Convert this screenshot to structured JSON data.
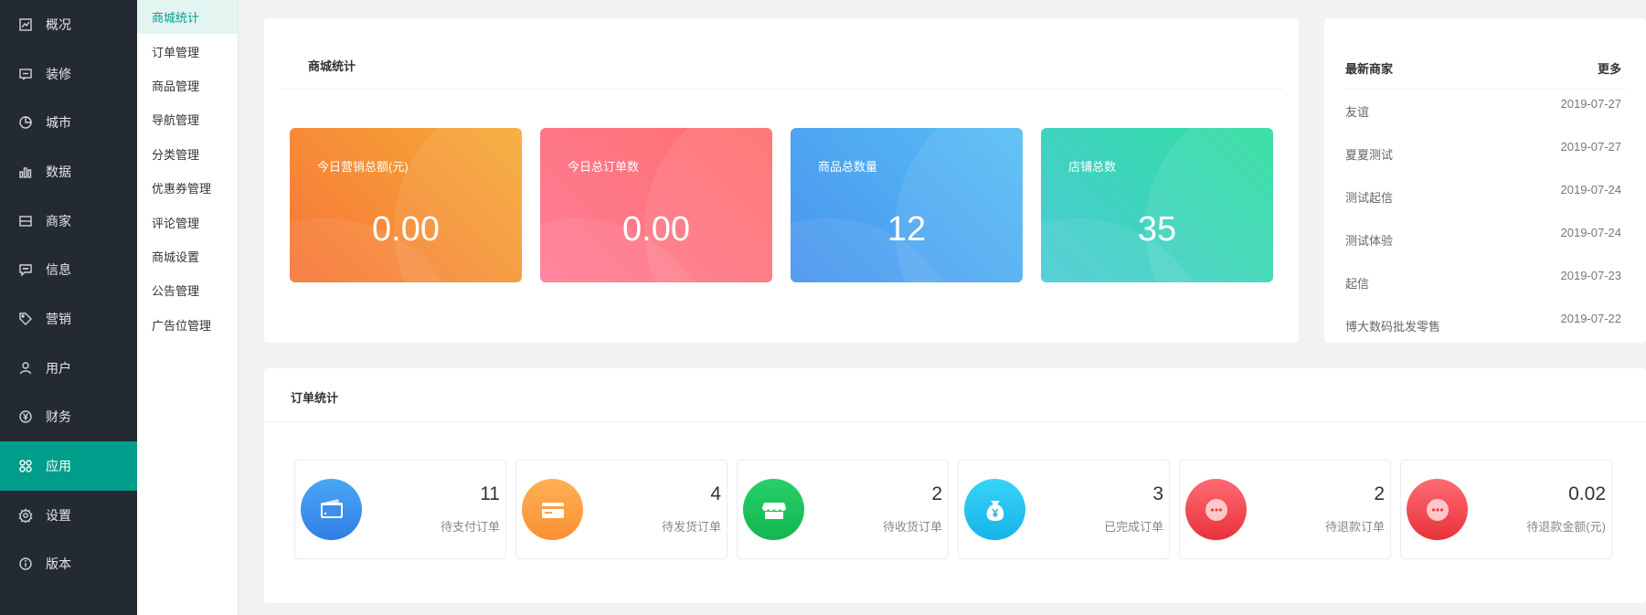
{
  "sidebar": {
    "items": [
      {
        "label": "概况",
        "icon": "overview-icon"
      },
      {
        "label": "装修",
        "icon": "decoration-icon"
      },
      {
        "label": "城市",
        "icon": "city-icon"
      },
      {
        "label": "数据",
        "icon": "chart-icon"
      },
      {
        "label": "商家",
        "icon": "merchant-icon"
      },
      {
        "label": "信息",
        "icon": "message-icon"
      },
      {
        "label": "营销",
        "icon": "tag-icon"
      },
      {
        "label": "用户",
        "icon": "user-icon"
      },
      {
        "label": "财务",
        "icon": "yen-icon"
      },
      {
        "label": "应用",
        "icon": "apps-icon"
      },
      {
        "label": "设置",
        "icon": "gear-icon"
      },
      {
        "label": "版本",
        "icon": "info-icon"
      }
    ],
    "active_index": 9,
    "accent_color": "#009e8a"
  },
  "subnav": {
    "items": [
      "商城统计",
      "订单管理",
      "商品管理",
      "导航管理",
      "分类管理",
      "优惠券管理",
      "评论管理",
      "商城设置",
      "公告管理",
      "广告位管理"
    ],
    "active_index": 0
  },
  "mall_stats": {
    "title": "商城统计",
    "cards": [
      {
        "label": "今日营销总额(元)",
        "value": "0.00"
      },
      {
        "label": "今日总订单数",
        "value": "0.00"
      },
      {
        "label": "商品总数量",
        "value": "12"
      },
      {
        "label": "店铺总数",
        "value": "35"
      }
    ]
  },
  "merchants": {
    "title": "最新商家",
    "more_label": "更多",
    "rows": [
      {
        "name": "友谊",
        "date": "2019-07-27"
      },
      {
        "name": "夏夏测试",
        "date": "2019-07-27"
      },
      {
        "name": "测试起信",
        "date": "2019-07-24"
      },
      {
        "name": "测试体验",
        "date": "2019-07-24"
      },
      {
        "name": "起信",
        "date": "2019-07-23"
      },
      {
        "name": "博大数码批发零售",
        "date": "2019-07-22"
      }
    ]
  },
  "order_stats": {
    "title": "订单统计",
    "cards": [
      {
        "value": "11",
        "label": "待支付订单",
        "icon": "wallet-icon"
      },
      {
        "value": "4",
        "label": "待发货订单",
        "icon": "card-icon"
      },
      {
        "value": "2",
        "label": "待收货订单",
        "icon": "store-icon"
      },
      {
        "value": "3",
        "label": "已完成订单",
        "icon": "money-bag-icon"
      },
      {
        "value": "2",
        "label": "待退款订单",
        "icon": "more-icon"
      },
      {
        "value": "0.02",
        "label": "待退款金额(元)",
        "icon": "more-icon"
      }
    ]
  }
}
